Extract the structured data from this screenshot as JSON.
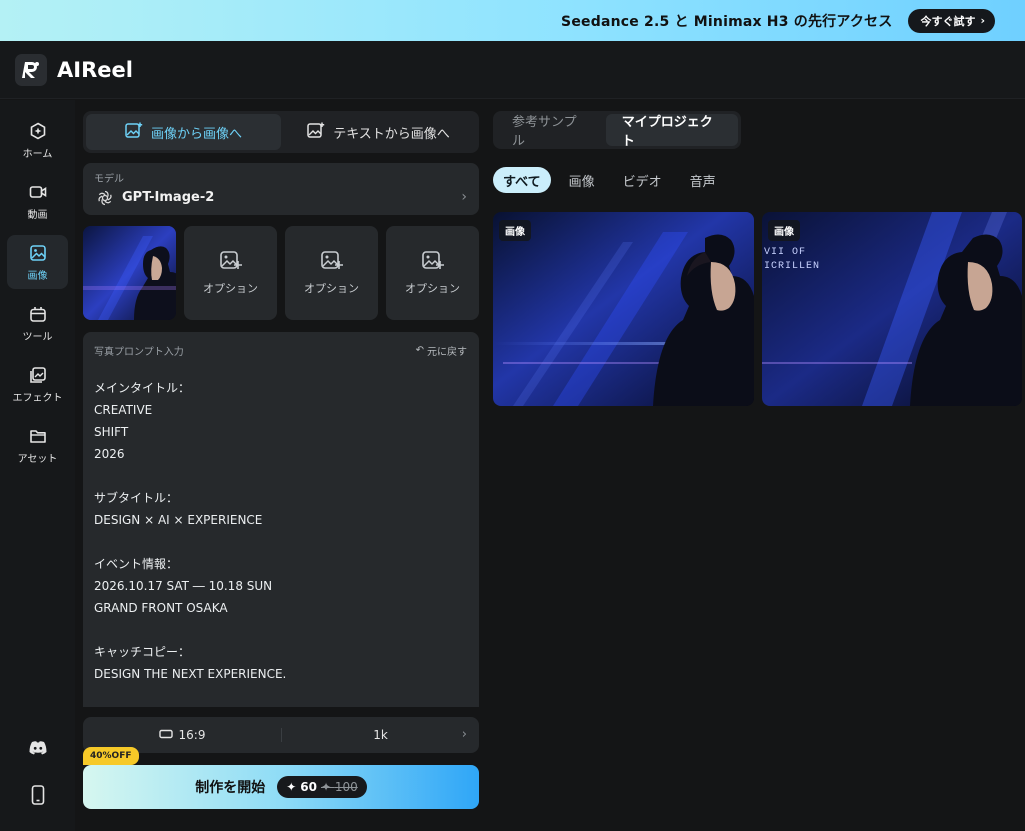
{
  "banner": {
    "text": "Seedance 2.5 と Minimax H3 の先行アクセス",
    "cta": "今すぐ試す"
  },
  "app": {
    "name_ai": "AI",
    "name_reel": "Reel"
  },
  "sidebar": {
    "items": [
      {
        "label": "ホーム",
        "icon": "home-icon"
      },
      {
        "label": "動画",
        "icon": "video-icon"
      },
      {
        "label": "画像",
        "icon": "image-icon"
      },
      {
        "label": "ツール",
        "icon": "tools-icon"
      },
      {
        "label": "エフェクト",
        "icon": "effects-icon"
      },
      {
        "label": "アセット",
        "icon": "folder-icon"
      }
    ],
    "active": "画像"
  },
  "mode_tabs": [
    {
      "label": "画像から画像へ"
    },
    {
      "label": "テキストから画像へ"
    }
  ],
  "model": {
    "label": "モデル",
    "name": "GPT-Image-2"
  },
  "thumbs": {
    "option_label": "オプション"
  },
  "prompt": {
    "heading": "写真プロンプト入力",
    "undo": "元に戻す",
    "text": "メインタイトル：\nCREATIVE\nSHIFT\n2026\n\nサブタイトル：\nDESIGN × AI × EXPERIENCE\n\nイベント情報：\n2026.10.17 SAT ― 10.18 SUN\nGRAND FRONT OSAKA\n\nキャッチコピー：\nDESIGN THE NEXT EXPERIENCE."
  },
  "ratio": {
    "aspect": "16:9",
    "resolution": "1k"
  },
  "start": {
    "badge": "40%OFF",
    "label": "制作を開始",
    "cost": "60",
    "cost_old": "100"
  },
  "project_tabs": [
    {
      "label": "参考サンプル"
    },
    {
      "label": "マイプロジェクト"
    }
  ],
  "filters": [
    {
      "label": "すべて"
    },
    {
      "label": "画像"
    },
    {
      "label": "ビデオ"
    },
    {
      "label": "音声"
    }
  ],
  "cards": [
    {
      "tag": "画像"
    },
    {
      "tag": "画像",
      "overlay_text_1": "VII OF",
      "overlay_text_2": "ICRILLEN"
    }
  ],
  "colors": {
    "accent": "#6ed2f8",
    "background": "#141516",
    "panel": "#26292c",
    "badge": "#f6c928"
  }
}
